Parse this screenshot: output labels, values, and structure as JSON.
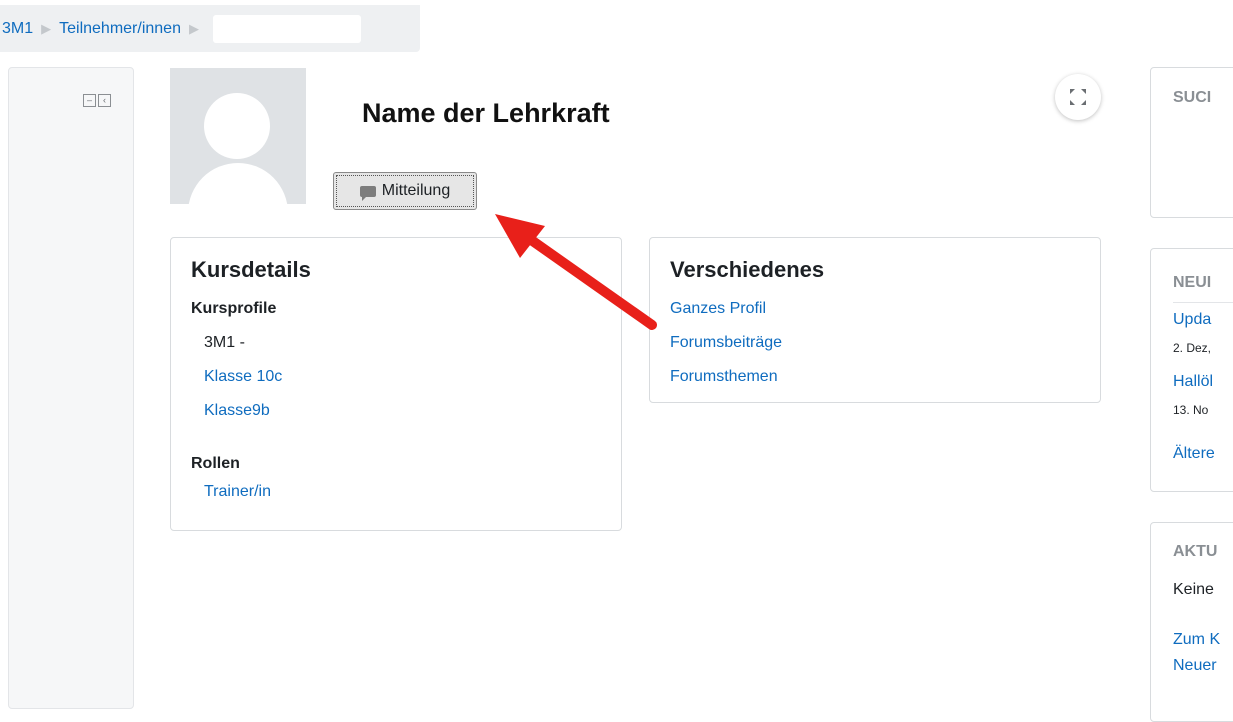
{
  "breadcrumb": {
    "items": [
      "3M1",
      "Teilnehmer/innen"
    ],
    "current": ""
  },
  "profile": {
    "name": "Name der Lehrkraft",
    "message_button_label": "Mitteilung"
  },
  "course_details": {
    "title": "Kursdetails",
    "course_profiles_label": "Kursprofile",
    "course_profiles": [
      "3M1 -",
      "Klasse 10c",
      "Klasse9b"
    ],
    "roles_label": "Rollen",
    "roles": [
      "Trainer/in"
    ]
  },
  "misc": {
    "title": "Verschiedenes",
    "links": [
      "Ganzes Profil",
      "Forumsbeiträge",
      "Forumsthemen"
    ]
  },
  "right_blocks": {
    "search": {
      "title": "SUCI"
    },
    "news": {
      "title": "NEUI",
      "items": [
        {
          "label": "Upda",
          "date": "2. Dez,"
        },
        {
          "label": "Hallöl",
          "date": "13. No"
        }
      ],
      "older_link": "Ältere"
    },
    "current": {
      "title": "AKTU",
      "text": "Keine",
      "link1": "Zum K",
      "link2": "Neuer"
    }
  },
  "colors": {
    "link": "#0f6cbf",
    "annotation_arrow": "#e8201a"
  },
  "icons": {
    "breadcrumb_separator": "triangle-right-icon",
    "message": "speech-bubble-icon",
    "expand": "fullscreen-expand-icon",
    "dock": "block-dock-icon"
  }
}
